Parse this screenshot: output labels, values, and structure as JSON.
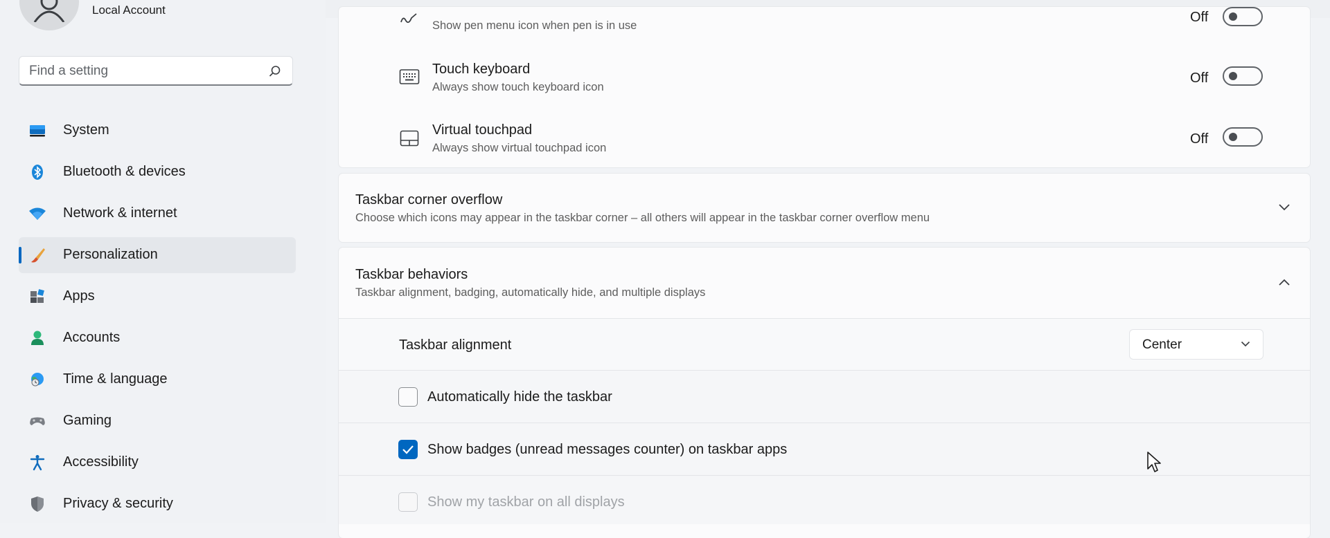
{
  "account": {
    "label": "Local Account"
  },
  "search": {
    "placeholder": "Find a setting"
  },
  "sidebar": {
    "items": [
      {
        "label": "System",
        "icon": "monitor-icon"
      },
      {
        "label": "Bluetooth & devices",
        "icon": "bluetooth-icon"
      },
      {
        "label": "Network & internet",
        "icon": "wifi-icon"
      },
      {
        "label": "Personalization",
        "icon": "brush-icon",
        "active": true
      },
      {
        "label": "Apps",
        "icon": "apps-icon"
      },
      {
        "label": "Accounts",
        "icon": "person-icon"
      },
      {
        "label": "Time & language",
        "icon": "globe-clock-icon"
      },
      {
        "label": "Gaming",
        "icon": "gamepad-icon"
      },
      {
        "label": "Accessibility",
        "icon": "accessibility-icon"
      },
      {
        "label": "Privacy & security",
        "icon": "shield-icon"
      }
    ]
  },
  "corner_icons": {
    "pen": {
      "subtitle": "Show pen menu icon when pen is in use",
      "state": "Off",
      "icon": "pen-icon"
    },
    "touch_keyboard": {
      "title": "Touch keyboard",
      "subtitle": "Always show touch keyboard icon",
      "state": "Off",
      "icon": "keyboard-icon"
    },
    "virtual_touchpad": {
      "title": "Virtual touchpad",
      "subtitle": "Always show virtual touchpad icon",
      "state": "Off",
      "icon": "touchpad-icon"
    }
  },
  "overflow": {
    "title": "Taskbar corner overflow",
    "subtitle": "Choose which icons may appear in the taskbar corner – all others will appear in the taskbar corner overflow menu"
  },
  "behaviors": {
    "title": "Taskbar behaviors",
    "subtitle": "Taskbar alignment, badging, automatically hide, and multiple displays",
    "alignment": {
      "label": "Taskbar alignment",
      "value": "Center"
    },
    "auto_hide": {
      "label": "Automatically hide the taskbar",
      "checked": false
    },
    "badges": {
      "label": "Show badges (unread messages counter) on taskbar apps",
      "checked": true
    },
    "all_displays": {
      "label": "Show my taskbar on all displays",
      "checked": false,
      "disabled": true
    }
  },
  "colors": {
    "accent": "#0067c0"
  }
}
